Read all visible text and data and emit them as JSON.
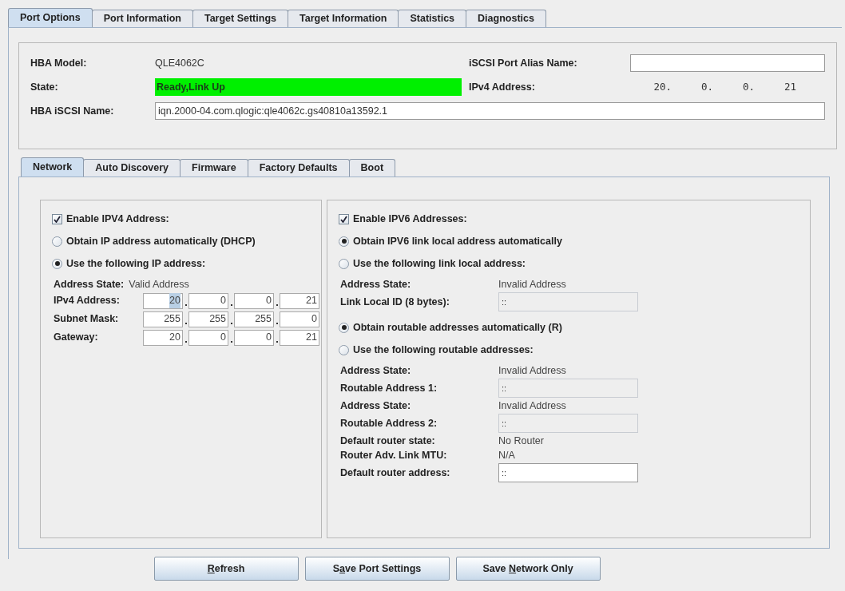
{
  "tabs": [
    {
      "label": "Port Options",
      "selected": true
    },
    {
      "label": "Port Information",
      "selected": false
    },
    {
      "label": "Target Settings",
      "selected": false
    },
    {
      "label": "Target Information",
      "selected": false
    },
    {
      "label": "Statistics",
      "selected": false
    },
    {
      "label": "Diagnostics",
      "selected": false
    }
  ],
  "info": {
    "hba_model_label": "HBA Model:",
    "hba_model": "QLE4062C",
    "state_label": "State:",
    "state": "Ready,Link Up",
    "state_ok": true,
    "alias_label": "iSCSI Port Alias Name:",
    "ipv4_label": "IPv4 Address:",
    "ipv4_octets": [
      "20.",
      "0.",
      "0.",
      "21"
    ],
    "iscsi_name_label": "HBA iSCSI Name:",
    "iscsi_name": "iqn.2000-04.com.qlogic:qle4062c.gs40810a13592.1"
  },
  "subtabs": [
    {
      "label": "Network",
      "selected": true
    },
    {
      "label": "Auto Discovery",
      "selected": false
    },
    {
      "label": "Firmware",
      "selected": false
    },
    {
      "label": "Factory Defaults",
      "selected": false
    },
    {
      "label": "Boot",
      "selected": false
    }
  ],
  "ipv4": {
    "enable": {
      "label": "Enable IPV4 Address:",
      "checked": true
    },
    "options": [
      {
        "label": "Obtain IP address automatically (DHCP)",
        "selected": false
      },
      {
        "label": "Use the following IP address:",
        "selected": true
      }
    ],
    "state_label": "Address State:",
    "state": "Valid Address",
    "fields": [
      {
        "label": "IPv4 Address:",
        "octets": [
          {
            "value": "20",
            "selected": true
          },
          {
            "value": "0",
            "selected": false
          },
          {
            "value": "0",
            "selected": false
          },
          {
            "value": "21",
            "selected": false
          }
        ]
      },
      {
        "label": "Subnet Mask:",
        "octets": [
          {
            "value": "255",
            "selected": false
          },
          {
            "value": "255",
            "selected": false
          },
          {
            "value": "255",
            "selected": false
          },
          {
            "value": "0",
            "selected": false
          }
        ]
      },
      {
        "label": "Gateway:",
        "octets": [
          {
            "value": "20",
            "selected": false
          },
          {
            "value": "0",
            "selected": false
          },
          {
            "value": "0",
            "selected": false
          },
          {
            "value": "21",
            "selected": false
          }
        ]
      }
    ]
  },
  "ipv6": {
    "enable": {
      "label": "Enable IPV6 Addresses:",
      "checked": true
    },
    "items": [
      {
        "kind": "radio",
        "label": "Obtain IPV6 link local address automatically",
        "selected": true
      },
      {
        "kind": "radio",
        "label": "Use the following link local address:",
        "selected": false
      },
      {
        "kind": "text",
        "label": "Address State:",
        "value": "Invalid Address"
      },
      {
        "kind": "field",
        "label": "Link Local ID (8 bytes):",
        "value": "::",
        "disabled": true
      },
      {
        "kind": "radio",
        "label": "Obtain routable addresses automatically (R)",
        "selected": true
      },
      {
        "kind": "radio",
        "label": "Use the following routable addresses:",
        "selected": false
      },
      {
        "kind": "text",
        "label": "Address State:",
        "value": "Invalid Address"
      },
      {
        "kind": "field",
        "label": "Routable Address 1:",
        "value": "::",
        "disabled": true
      },
      {
        "kind": "text",
        "label": "Address State:",
        "value": "Invalid Address"
      },
      {
        "kind": "field",
        "label": "Routable Address 2:",
        "value": "::",
        "disabled": true
      },
      {
        "kind": "text",
        "label": "Default router state:",
        "value": "No Router"
      },
      {
        "kind": "text",
        "label": "Router Adv. Link MTU:",
        "value": "N/A"
      },
      {
        "kind": "field",
        "label": "Default router address:",
        "value": "::",
        "disabled": false
      }
    ]
  },
  "buttons": [
    {
      "parts": [
        {
          "text": "R",
          "underlined": true
        },
        {
          "text": "efresh",
          "underlined": false
        }
      ]
    },
    {
      "parts": [
        {
          "text": "S",
          "underlined": false
        },
        {
          "text": "a",
          "underlined": true
        },
        {
          "text": "ve Port Settings",
          "underlined": false
        }
      ]
    },
    {
      "parts": [
        {
          "text": "Save ",
          "underlined": false
        },
        {
          "text": "N",
          "underlined": true
        },
        {
          "text": "etwork Only",
          "underlined": false
        }
      ]
    }
  ]
}
